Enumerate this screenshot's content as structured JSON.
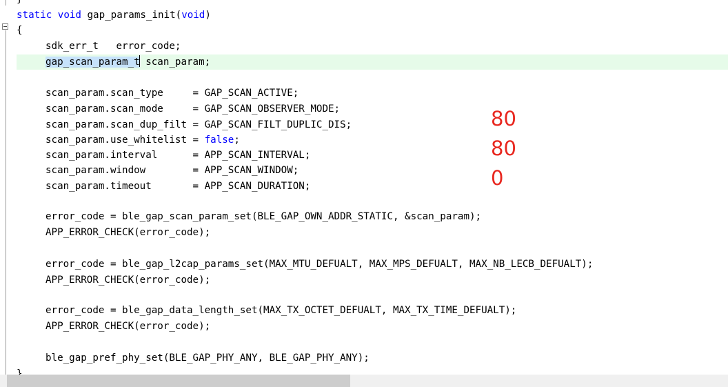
{
  "editor": {
    "lines": [
      {
        "id": "l0",
        "text": "}"
      },
      {
        "id": "l1",
        "segments": [
          {
            "kw": "static"
          },
          {
            "t": " "
          },
          {
            "kw": "void"
          },
          {
            "t": " gap_params_init("
          },
          {
            "kw": "void"
          },
          {
            "t": ")"
          }
        ]
      },
      {
        "id": "l2",
        "text": "{"
      },
      {
        "id": "l3",
        "text": "sdk_err_t   error_code;"
      },
      {
        "id": "l4",
        "selected": "gap_scan_param_t",
        "rest": " scan_param;"
      },
      {
        "id": "l5",
        "text": ""
      },
      {
        "id": "l6",
        "text": "scan_param.scan_type     = GAP_SCAN_ACTIVE;"
      },
      {
        "id": "l7",
        "text": "scan_param.scan_mode     = GAP_SCAN_OBSERVER_MODE;"
      },
      {
        "id": "l8",
        "text": "scan_param.scan_dup_filt = GAP_SCAN_FILT_DUPLIC_DIS;"
      },
      {
        "id": "l9",
        "segments": [
          {
            "t": "scan_param.use_whitelist = "
          },
          {
            "kw": "false"
          },
          {
            "t": ";"
          }
        ]
      },
      {
        "id": "l10",
        "text": "scan_param.interval      = APP_SCAN_INTERVAL;"
      },
      {
        "id": "l11",
        "text": "scan_param.window        = APP_SCAN_WINDOW;"
      },
      {
        "id": "l12",
        "text": "scan_param.timeout       = APP_SCAN_DURATION;"
      },
      {
        "id": "l13",
        "text": ""
      },
      {
        "id": "l14",
        "text": "error_code = ble_gap_scan_param_set(BLE_GAP_OWN_ADDR_STATIC, &scan_param);"
      },
      {
        "id": "l15",
        "text": "APP_ERROR_CHECK(error_code);"
      },
      {
        "id": "l16",
        "text": ""
      },
      {
        "id": "l17",
        "text": "error_code = ble_gap_l2cap_params_set(MAX_MTU_DEFUALT, MAX_MPS_DEFUALT, MAX_NB_LECB_DEFUALT);"
      },
      {
        "id": "l18",
        "text": "APP_ERROR_CHECK(error_code);"
      },
      {
        "id": "l19",
        "text": ""
      },
      {
        "id": "l20",
        "text": "error_code = ble_gap_data_length_set(MAX_TX_OCTET_DEFUALT, MAX_TX_TIME_DEFUALT);"
      },
      {
        "id": "l21",
        "text": "APP_ERROR_CHECK(error_code);"
      },
      {
        "id": "l22",
        "text": ""
      },
      {
        "id": "l23",
        "text": "ble_gap_pref_phy_set(BLE_GAP_PHY_ANY, BLE_GAP_PHY_ANY);"
      },
      {
        "id": "l24",
        "text": "}"
      }
    ]
  },
  "annotation": {
    "values": [
      "80",
      "80",
      "0"
    ],
    "color": "#e8271f"
  },
  "colors": {
    "keyword": "#0000ff",
    "current_line": "#e6fbe9",
    "selection": "#c6e2fb"
  }
}
